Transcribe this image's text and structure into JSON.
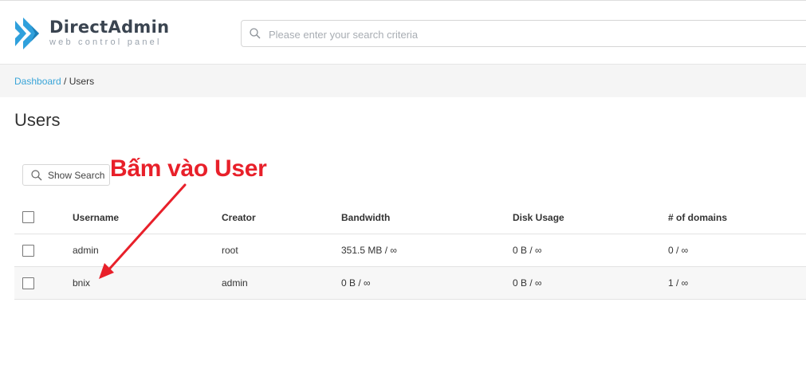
{
  "header": {
    "brand": "DirectAdmin",
    "tagline": "web control panel",
    "search_placeholder": "Please enter your search criteria"
  },
  "breadcrumb": {
    "home": "Dashboard",
    "separator": " / ",
    "current": "Users"
  },
  "page": {
    "title": "Users"
  },
  "toolbar": {
    "show_search_label": "Show Search"
  },
  "annotation": {
    "text": "Bấm vào User",
    "color": "#e8202a"
  },
  "table": {
    "columns": [
      "Username",
      "Creator",
      "Bandwidth",
      "Disk Usage",
      "# of domains"
    ],
    "rows": [
      {
        "username": "admin",
        "creator": "root",
        "bandwidth": "351.5 MB / ∞",
        "disk": "0 B / ∞",
        "domains": "0 / ∞"
      },
      {
        "username": "bnix",
        "creator": "admin",
        "bandwidth": "0 B / ∞",
        "disk": "0 B / ∞",
        "domains": "1 / ∞"
      }
    ]
  },
  "colors": {
    "link": "#3aa5d8",
    "logo": "#2fa0dc",
    "breadcrumb_bg": "#f5f5f5"
  },
  "icons": {
    "logo": "directadmin-logo-icon",
    "search": "search-icon",
    "checkbox": "checkbox-icon"
  }
}
